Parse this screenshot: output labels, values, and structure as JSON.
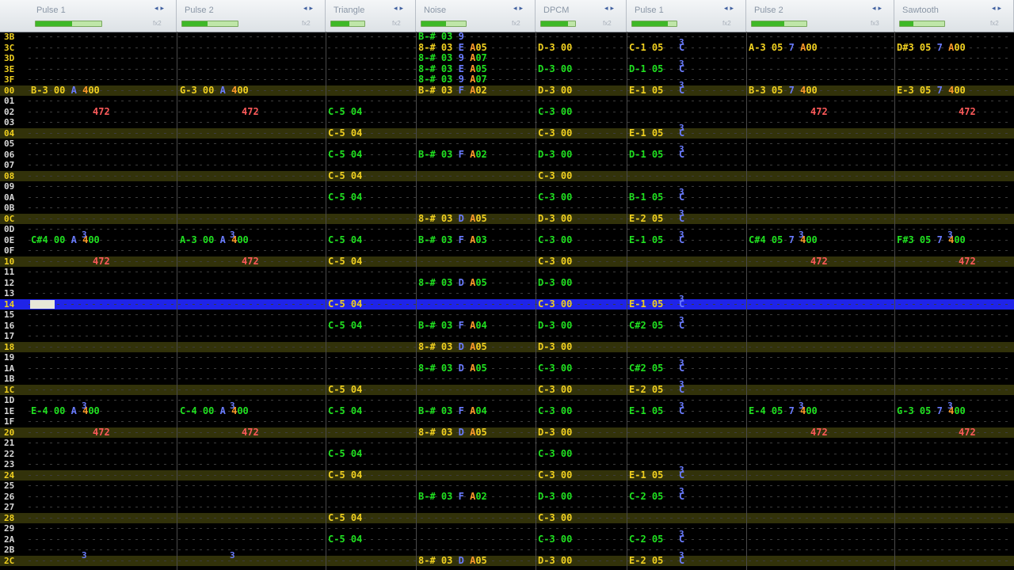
{
  "channels": [
    {
      "name": "Pulse 1",
      "level": 0.55,
      "fx": "fx2"
    },
    {
      "name": "Pulse 2",
      "level": 0.45,
      "fx": "fx2"
    },
    {
      "name": "Triangle",
      "level": 0.55,
      "fx": "fx2"
    },
    {
      "name": "Noise",
      "level": 0.55,
      "fx": "fx2"
    },
    {
      "name": "DPCM",
      "level": 0.8,
      "fx": "fx2"
    },
    {
      "name": "Pulse 1",
      "level": 0.8,
      "fx": "fx2"
    },
    {
      "name": "Pulse 2",
      "level": 0.6,
      "fx": "fx3"
    },
    {
      "name": "Sawtooth",
      "level": 0.3,
      "fx": "fx2"
    }
  ],
  "rows": [
    "3B",
    "3C",
    "3D",
    "3E",
    "3F",
    "00",
    "01",
    "02",
    "03",
    "04",
    "05",
    "06",
    "07",
    "08",
    "09",
    "0A",
    "0B",
    "0C",
    "0D",
    "0E",
    "0F",
    "10",
    "11",
    "12",
    "13",
    "14",
    "15",
    "16",
    "17",
    "18",
    "19",
    "1A",
    "1B",
    "1C",
    "1D",
    "1E",
    "1F",
    "20",
    "21",
    "22",
    "23",
    "24",
    "25",
    "26",
    "27",
    "28",
    "29",
    "2A",
    "2B",
    "2C"
  ],
  "cursor_row": "14",
  "notes": {
    "pulse1": [
      {
        "row": "00",
        "n": "B-3",
        "v": "00",
        "i": "A",
        "e": "400",
        "c": "y"
      },
      {
        "row": "02",
        "e2": "472"
      },
      {
        "row": "0E",
        "n": "C#4",
        "v": "00",
        "i": "A",
        "e": "400",
        "c": "g"
      },
      {
        "row": "10",
        "e2": "472"
      },
      {
        "row": "1E",
        "n": "E-4",
        "v": "00",
        "i": "A",
        "e": "400",
        "c": "g"
      },
      {
        "row": "20",
        "e2": "472"
      }
    ],
    "pulse2": [
      {
        "row": "00",
        "n": "G-3",
        "v": "00",
        "i": "A",
        "e": "400",
        "c": "y"
      },
      {
        "row": "02",
        "e2": "472"
      },
      {
        "row": "0E",
        "n": "A-3",
        "v": "00",
        "i": "A",
        "e": "400",
        "c": "g"
      },
      {
        "row": "10",
        "e2": "472"
      },
      {
        "row": "1E",
        "n": "C-4",
        "v": "00",
        "i": "A",
        "e": "400",
        "c": "g"
      },
      {
        "row": "20",
        "e2": "472"
      }
    ],
    "triangle": [
      {
        "row": "02",
        "t": "C-5 04",
        "c": "g"
      },
      {
        "row": "04",
        "t": "C-5 04",
        "c": "y"
      },
      {
        "row": "06",
        "t": "C-5 04",
        "c": "g"
      },
      {
        "row": "08",
        "t": "C-5 04",
        "c": "y"
      },
      {
        "row": "0A",
        "t": "C-5 04",
        "c": "g"
      },
      {
        "row": "0E",
        "t": "C-5 04",
        "c": "g"
      },
      {
        "row": "10",
        "t": "C-5 04",
        "c": "y"
      },
      {
        "row": "14",
        "t": "C-5 04",
        "c": "y"
      },
      {
        "row": "16",
        "t": "C-5 04",
        "c": "g"
      },
      {
        "row": "1C",
        "t": "C-5 04",
        "c": "y"
      },
      {
        "row": "1E",
        "t": "C-5 04",
        "c": "g"
      },
      {
        "row": "22",
        "t": "C-5 04",
        "c": "g"
      },
      {
        "row": "24",
        "t": "C-5 04",
        "c": "y"
      },
      {
        "row": "28",
        "t": "C-5 04",
        "c": "y"
      },
      {
        "row": "2A",
        "t": "C-5 04",
        "c": "g"
      }
    ],
    "noise": [
      {
        "row": "3B",
        "n": "B-#",
        "v": "03",
        "i": "9",
        "e": "",
        "c": "g"
      },
      {
        "row": "3C",
        "n": "8-#",
        "v": "03",
        "i": "E",
        "e": "A05",
        "c": "y"
      },
      {
        "row": "3D",
        "n": "8-#",
        "v": "03",
        "i": "9",
        "e": "A07",
        "c": "g"
      },
      {
        "row": "3E",
        "n": "8-#",
        "v": "03",
        "i": "E",
        "e": "A05",
        "c": "g"
      },
      {
        "row": "3F",
        "n": "8-#",
        "v": "03",
        "i": "9",
        "e": "A07",
        "c": "g"
      },
      {
        "row": "00",
        "n": "B-#",
        "v": "03",
        "i": "F",
        "e": "A02",
        "c": "y"
      },
      {
        "row": "06",
        "n": "B-#",
        "v": "03",
        "i": "F",
        "e": "A02",
        "c": "g"
      },
      {
        "row": "0C",
        "n": "8-#",
        "v": "03",
        "i": "D",
        "e": "A05",
        "c": "y"
      },
      {
        "row": "0E",
        "n": "B-#",
        "v": "03",
        "i": "F",
        "e": "A03",
        "c": "g"
      },
      {
        "row": "12",
        "n": "8-#",
        "v": "03",
        "i": "D",
        "e": "A05",
        "c": "g"
      },
      {
        "row": "16",
        "n": "B-#",
        "v": "03",
        "i": "F",
        "e": "A04",
        "c": "g"
      },
      {
        "row": "18",
        "n": "8-#",
        "v": "03",
        "i": "D",
        "e": "A05",
        "c": "y"
      },
      {
        "row": "1A",
        "n": "8-#",
        "v": "03",
        "i": "D",
        "e": "A05",
        "c": "g"
      },
      {
        "row": "1E",
        "n": "B-#",
        "v": "03",
        "i": "F",
        "e": "A04",
        "c": "g"
      },
      {
        "row": "20",
        "n": "8-#",
        "v": "03",
        "i": "D",
        "e": "A05",
        "c": "y"
      },
      {
        "row": "26",
        "n": "B-#",
        "v": "03",
        "i": "F",
        "e": "A02",
        "c": "g"
      },
      {
        "row": "2C",
        "n": "8-#",
        "v": "03",
        "i": "D",
        "e": "A05",
        "c": "y"
      }
    ],
    "dpcm": [
      {
        "row": "3C",
        "t": "D-3 00",
        "c": "y"
      },
      {
        "row": "3E",
        "t": "D-3 00",
        "c": "g"
      },
      {
        "row": "00",
        "t": "D-3 00",
        "c": "y"
      },
      {
        "row": "02",
        "t": "C-3 00",
        "c": "g"
      },
      {
        "row": "04",
        "t": "C-3 00",
        "c": "y"
      },
      {
        "row": "06",
        "t": "D-3 00",
        "c": "g"
      },
      {
        "row": "08",
        "t": "C-3 00",
        "c": "y"
      },
      {
        "row": "0A",
        "t": "C-3 00",
        "c": "g"
      },
      {
        "row": "0C",
        "t": "D-3 00",
        "c": "y"
      },
      {
        "row": "0E",
        "t": "C-3 00",
        "c": "g"
      },
      {
        "row": "10",
        "t": "C-3 00",
        "c": "y"
      },
      {
        "row": "12",
        "t": "D-3 00",
        "c": "g"
      },
      {
        "row": "14",
        "t": "C-3 00",
        "c": "y"
      },
      {
        "row": "16",
        "t": "D-3 00",
        "c": "g"
      },
      {
        "row": "18",
        "t": "D-3 00",
        "c": "y"
      },
      {
        "row": "1A",
        "t": "C-3 00",
        "c": "g"
      },
      {
        "row": "1C",
        "t": "C-3 00",
        "c": "y"
      },
      {
        "row": "1E",
        "t": "C-3 00",
        "c": "g"
      },
      {
        "row": "20",
        "t": "D-3 00",
        "c": "y"
      },
      {
        "row": "22",
        "t": "C-3 00",
        "c": "g"
      },
      {
        "row": "24",
        "t": "C-3 00",
        "c": "y"
      },
      {
        "row": "26",
        "t": "D-3 00",
        "c": "g"
      },
      {
        "row": "28",
        "t": "C-3 00",
        "c": "y"
      },
      {
        "row": "2A",
        "t": "C-3 00",
        "c": "g"
      },
      {
        "row": "2C",
        "t": "D-3 00",
        "c": "y"
      }
    ],
    "pulse1b": [
      {
        "row": "3C",
        "t": "C-1 05",
        "c": "y"
      },
      {
        "row": "3E",
        "t": "D-1 05",
        "c": "g"
      },
      {
        "row": "00",
        "t": "E-1 05",
        "c": "y"
      },
      {
        "row": "04",
        "t": "E-1 05",
        "c": "y"
      },
      {
        "row": "06",
        "t": "D-1 05",
        "c": "g"
      },
      {
        "row": "0A",
        "t": "B-1 05",
        "c": "g"
      },
      {
        "row": "0C",
        "t": "E-2 05",
        "c": "y"
      },
      {
        "row": "0E",
        "t": "E-1 05",
        "c": "g"
      },
      {
        "row": "14",
        "t": "E-1 05",
        "c": "y"
      },
      {
        "row": "16",
        "t": "C#2 05",
        "c": "g"
      },
      {
        "row": "1A",
        "t": "C#2 05",
        "c": "g"
      },
      {
        "row": "1C",
        "t": "E-2 05",
        "c": "y"
      },
      {
        "row": "1E",
        "t": "E-1 05",
        "c": "g"
      },
      {
        "row": "24",
        "t": "E-1 05",
        "c": "y"
      },
      {
        "row": "26",
        "t": "C-2 05",
        "c": "g"
      },
      {
        "row": "2A",
        "t": "C-2 05",
        "c": "g"
      },
      {
        "row": "2C",
        "t": "E-2 05",
        "c": "y"
      }
    ],
    "pulse2b": [
      {
        "row": "3C",
        "n": "A-3",
        "v": "05",
        "i": "7",
        "e": "A00",
        "c": "y"
      },
      {
        "row": "00",
        "n": "B-3",
        "v": "05",
        "i": "7",
        "e": "400",
        "c": "y"
      },
      {
        "row": "02",
        "e2": "472"
      },
      {
        "row": "0E",
        "n": "C#4",
        "v": "05",
        "i": "7",
        "e": "400",
        "c": "g"
      },
      {
        "row": "10",
        "e2": "472"
      },
      {
        "row": "1E",
        "n": "E-4",
        "v": "05",
        "i": "7",
        "e": "400",
        "c": "g"
      },
      {
        "row": "20",
        "e2": "472"
      }
    ],
    "saw": [
      {
        "row": "3C",
        "n": "D#3",
        "v": "05",
        "i": "7",
        "e": "A00",
        "c": "y"
      },
      {
        "row": "00",
        "n": "E-3",
        "v": "05",
        "i": "7",
        "e": "400",
        "c": "y"
      },
      {
        "row": "02",
        "e2": "472"
      },
      {
        "row": "0E",
        "n": "F#3",
        "v": "05",
        "i": "7",
        "e": "400",
        "c": "g"
      },
      {
        "row": "10",
        "e2": "472"
      },
      {
        "row": "1E",
        "n": "G-3",
        "v": "05",
        "i": "7",
        "e": "400",
        "c": "g"
      },
      {
        "row": "20",
        "e2": "472"
      }
    ]
  },
  "markers": {
    "three": "3",
    "c": "C"
  }
}
